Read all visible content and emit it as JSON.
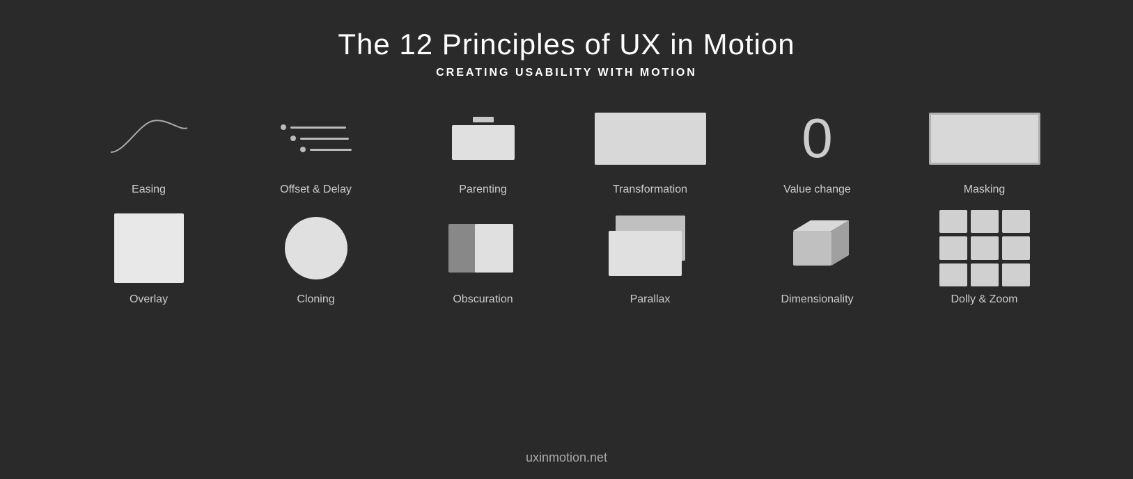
{
  "header": {
    "title": "The 12 Principles of UX in Motion",
    "subtitle": "CREATING USABILITY WITH MOTION"
  },
  "principles": {
    "row1": [
      {
        "id": "easing",
        "label": "Easing"
      },
      {
        "id": "offset-delay",
        "label": "Offset & Delay"
      },
      {
        "id": "parenting",
        "label": "Parenting"
      },
      {
        "id": "transformation",
        "label": "Transformation"
      },
      {
        "id": "value-change",
        "label": "Value change",
        "value": "0"
      },
      {
        "id": "masking",
        "label": "Masking"
      }
    ],
    "row2": [
      {
        "id": "overlay",
        "label": "Overlay"
      },
      {
        "id": "cloning",
        "label": "Cloning"
      },
      {
        "id": "obscuration",
        "label": "Obscuration"
      },
      {
        "id": "parallax",
        "label": "Parallax"
      },
      {
        "id": "dimensionality",
        "label": "Dimensionality"
      },
      {
        "id": "dolly-zoom",
        "label": "Dolly & Zoom"
      }
    ]
  },
  "footer": {
    "url": "uxinmotion.net"
  }
}
